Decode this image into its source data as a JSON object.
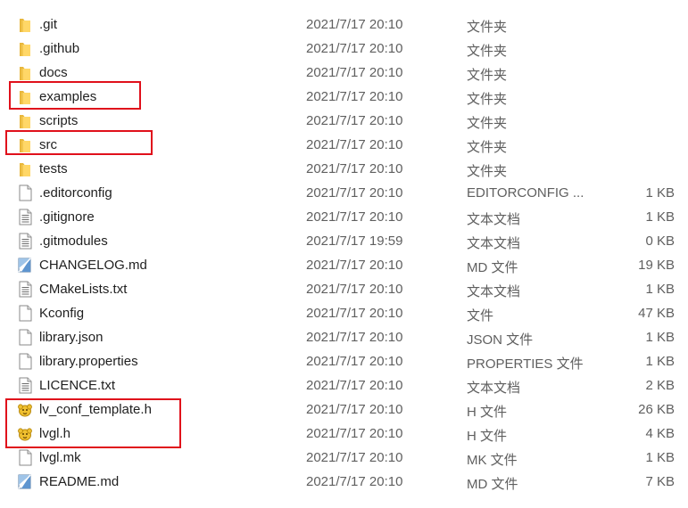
{
  "highlight_color": "#e0101b",
  "files": [
    {
      "name": ".git",
      "date": "2021/7/17 20:10",
      "type": "文件夹",
      "size": "",
      "icon": "folder-icon"
    },
    {
      "name": ".github",
      "date": "2021/7/17 20:10",
      "type": "文件夹",
      "size": "",
      "icon": "folder-icon"
    },
    {
      "name": "docs",
      "date": "2021/7/17 20:10",
      "type": "文件夹",
      "size": "",
      "icon": "folder-icon"
    },
    {
      "name": "examples",
      "date": "2021/7/17 20:10",
      "type": "文件夹",
      "size": "",
      "icon": "folder-icon"
    },
    {
      "name": "scripts",
      "date": "2021/7/17 20:10",
      "type": "文件夹",
      "size": "",
      "icon": "folder-icon"
    },
    {
      "name": "src",
      "date": "2021/7/17 20:10",
      "type": "文件夹",
      "size": "",
      "icon": "folder-icon"
    },
    {
      "name": "tests",
      "date": "2021/7/17 20:10",
      "type": "文件夹",
      "size": "",
      "icon": "folder-icon"
    },
    {
      "name": ".editorconfig",
      "date": "2021/7/17 20:10",
      "type": "EDITORCONFIG ...",
      "size": "1 KB",
      "icon": "blank-file-icon"
    },
    {
      "name": ".gitignore",
      "date": "2021/7/17 20:10",
      "type": "文本文档",
      "size": "1 KB",
      "icon": "text-file-icon"
    },
    {
      "name": ".gitmodules",
      "date": "2021/7/17 19:59",
      "type": "文本文档",
      "size": "0 KB",
      "icon": "text-file-icon"
    },
    {
      "name": "CHANGELOG.md",
      "date": "2021/7/17 20:10",
      "type": "MD 文件",
      "size": "19 KB",
      "icon": "markdown-file-icon"
    },
    {
      "name": "CMakeLists.txt",
      "date": "2021/7/17 20:10",
      "type": "文本文档",
      "size": "1 KB",
      "icon": "text-file-icon"
    },
    {
      "name": "Kconfig",
      "date": "2021/7/17 20:10",
      "type": "文件",
      "size": "47 KB",
      "icon": "blank-file-icon"
    },
    {
      "name": "library.json",
      "date": "2021/7/17 20:10",
      "type": "JSON 文件",
      "size": "1 KB",
      "icon": "blank-file-icon"
    },
    {
      "name": "library.properties",
      "date": "2021/7/17 20:10",
      "type": "PROPERTIES 文件",
      "size": "1 KB",
      "icon": "blank-file-icon"
    },
    {
      "name": "LICENCE.txt",
      "date": "2021/7/17 20:10",
      "type": "文本文档",
      "size": "2 KB",
      "icon": "text-file-icon"
    },
    {
      "name": "lv_conf_template.h",
      "date": "2021/7/17 20:10",
      "type": "H 文件",
      "size": "26 KB",
      "icon": "header-file-icon"
    },
    {
      "name": "lvgl.h",
      "date": "2021/7/17 20:10",
      "type": "H 文件",
      "size": "4 KB",
      "icon": "header-file-icon"
    },
    {
      "name": "lvgl.mk",
      "date": "2021/7/17 20:10",
      "type": "MK 文件",
      "size": "1 KB",
      "icon": "blank-file-icon"
    },
    {
      "name": "README.md",
      "date": "2021/7/17 20:10",
      "type": "MD 文件",
      "size": "7 KB",
      "icon": "markdown-file-icon"
    }
  ]
}
